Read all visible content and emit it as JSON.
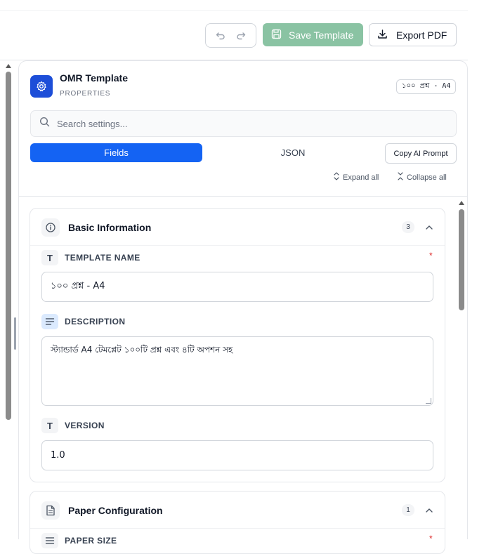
{
  "toolbar": {
    "save_label": "Save Template",
    "export_label": "Export PDF",
    "save_color": "#8ac3a3"
  },
  "panel": {
    "title": "OMR Template",
    "subtitle": "PROPERTIES",
    "badge": "১০০ প্রশ্ন - A4",
    "accent": "#1463f3"
  },
  "search": {
    "placeholder": "Search settings..."
  },
  "tabs": [
    {
      "label": "Fields",
      "active": true
    },
    {
      "label": "JSON",
      "active": false
    }
  ],
  "actions": {
    "copy_ai": "Copy AI Prompt",
    "expand_all": "Expand all",
    "collapse_all": "Collapse all"
  },
  "sections": {
    "basic": {
      "title": "Basic Information",
      "count": "3",
      "fields": {
        "template_name": {
          "label": "TEMPLATE NAME",
          "required": "*",
          "value": "১০০ প্রশ্ন - A4"
        },
        "description": {
          "label": "DESCRIPTION",
          "value": "স্ট্যান্ডার্ড A4 টেমপ্লেট ১০০টি প্রশ্ন এবং ৪টি অপশন সহ"
        },
        "version": {
          "label": "VERSION",
          "value": "1.0"
        }
      }
    },
    "paper": {
      "title": "Paper Configuration",
      "count": "1",
      "fields": {
        "paper_size": {
          "label": "PAPER SIZE",
          "required": "*"
        }
      }
    }
  },
  "icons": {
    "undo": "undo-icon",
    "redo": "redo-icon",
    "save": "save-icon",
    "export": "download-icon",
    "header": "gear-icon",
    "search": "search-icon",
    "info": "info-icon",
    "document": "document-icon",
    "text": "text-type-icon",
    "align": "align-left-icon",
    "chevron": "chevron-up-icon"
  }
}
